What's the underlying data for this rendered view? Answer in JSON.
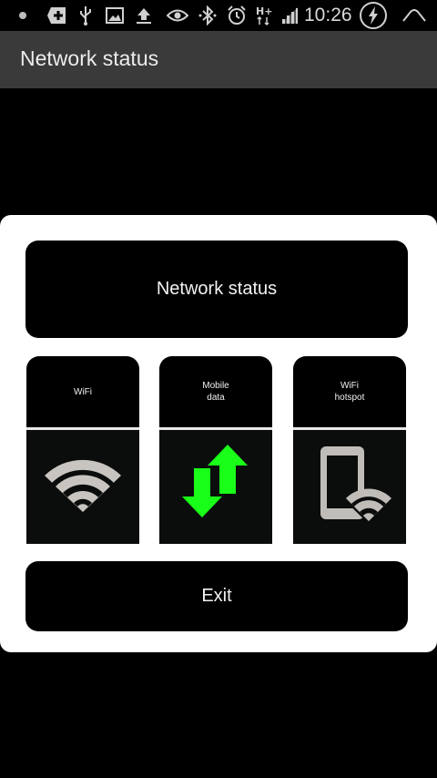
{
  "status_bar": {
    "time": "10:26",
    "network_type": "H+",
    "icons": [
      "notification-dot-icon",
      "add-icon",
      "usb-icon",
      "image-icon",
      "upload-icon",
      "eye-icon",
      "bluetooth-icon",
      "alarm-icon",
      "network-hplus-icon",
      "signal-icon",
      "battery-charging-icon",
      "chevron-up-icon"
    ]
  },
  "app_bar": {
    "title": "Network status"
  },
  "dialog": {
    "title_button": "Network status",
    "tiles": [
      {
        "label": "WiFi",
        "icon": "wifi-icon",
        "color": "#c8c4bf"
      },
      {
        "label": "Mobile\ndata",
        "icon": "mobile-data-icon",
        "color": "#19ff19"
      },
      {
        "label": "WiFi\nhotspot",
        "icon": "wifi-hotspot-icon",
        "color": "#c0bdb8"
      }
    ],
    "exit_button": "Exit"
  },
  "colors": {
    "background": "#000000",
    "app_bar": "#3a3a3a",
    "dialog": "#ffffff",
    "accent_green": "#19ff19"
  }
}
